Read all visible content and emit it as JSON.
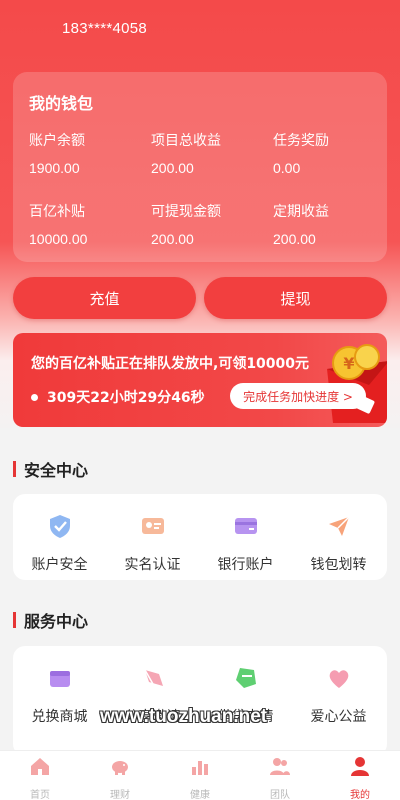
{
  "header": {
    "phone": "183****4058"
  },
  "wallet": {
    "title": "我的钱包",
    "items": [
      {
        "label": "账户余额",
        "value": "1900.00"
      },
      {
        "label": "项目总收益",
        "value": "200.00"
      },
      {
        "label": "任务奖励",
        "value": "0.00"
      },
      {
        "label": "百亿补贴",
        "value": "10000.00"
      },
      {
        "label": "可提现金额",
        "value": "200.00"
      },
      {
        "label": "定期收益",
        "value": "200.00"
      }
    ]
  },
  "actions": {
    "recharge": "充值",
    "withdraw": "提现"
  },
  "promo": {
    "text": "您的百亿补贴正在排队发放中,可领10000元",
    "countdown": "309天22小时29分46秒",
    "button": "完成任务加快进度 >"
  },
  "security": {
    "title": "安全中心",
    "items": [
      {
        "label": "账户安全",
        "icon": "shield-icon"
      },
      {
        "label": "实名认证",
        "icon": "id-card-icon"
      },
      {
        "label": "银行账户",
        "icon": "bank-card-icon"
      },
      {
        "label": "钱包划转",
        "icon": "transfer-icon"
      }
    ]
  },
  "services": {
    "title": "服务中心",
    "items": [
      {
        "label": "兑换商城",
        "icon": "mall-icon"
      },
      {
        "label": "分享邀请",
        "icon": "share-icon"
      },
      {
        "label": "借贷申请",
        "icon": "loan-icon"
      },
      {
        "label": "爱心公益",
        "icon": "charity-icon"
      }
    ]
  },
  "watermark": "www.tuozhuan.net",
  "tabbar": {
    "items": [
      {
        "label": "首页",
        "icon": "home-icon"
      },
      {
        "label": "理财",
        "icon": "piggy-bank-icon"
      },
      {
        "label": "健康",
        "icon": "health-icon"
      },
      {
        "label": "团队",
        "icon": "team-icon"
      },
      {
        "label": "我的",
        "icon": "profile-icon"
      }
    ],
    "active": "我的"
  },
  "colors": {
    "brand_red": "#f23f3f",
    "accent": "#e53535"
  }
}
